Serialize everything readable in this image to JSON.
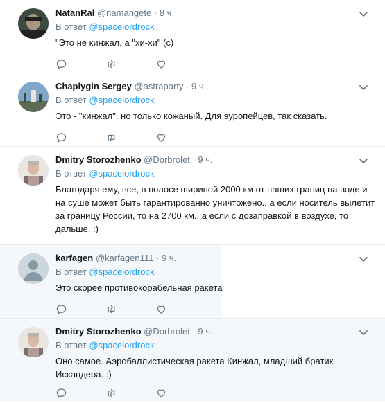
{
  "tweets": [
    {
      "name": "NatanRal",
      "handle": "@namangete",
      "time": "8 ч.",
      "reply_prefix": "В ответ",
      "reply_mention": "@spacelordrock",
      "text": "\"Это не кинжал, а \"хи-хи\" (с)"
    },
    {
      "name": "Chaplygin Sergey",
      "handle": "@astraparty",
      "time": "9 ч.",
      "reply_prefix": "В ответ",
      "reply_mention": "@spacelordrock",
      "text": "Это - \"кинжал\", но только кожаный. Для эуропейцев, так сказать."
    },
    {
      "name": "Dmitry Storozhenko",
      "handle": "@Dorbrolet",
      "time": "9 ч.",
      "reply_prefix": "В ответ",
      "reply_mention": "@spacelordrock",
      "text": "Благодаря ему, все, в полосе шириной 2000 км от наших границ на воде и на суше может быть гарантированно уничтожено., а если носитель вылетит за границу России, то на 2700 км., а если с дозаправкой в воздухе, то дальше. :)"
    },
    {
      "name": "karfagen",
      "handle": "@karfagen111",
      "time": "9 ч.",
      "reply_prefix": "В ответ",
      "reply_mention": "@spacelordrock",
      "text": "Это скорее противокорабельная ракета"
    },
    {
      "name": "Dmitry Storozhenko",
      "handle": "@Dorbrolet",
      "time": "9 ч.",
      "reply_prefix": "В ответ",
      "reply_mention": "@spacelordrock",
      "text": "Оно самое. Аэробаллистическая ракета Кинжал, младший братик Искандера. :)"
    }
  ],
  "icons": {
    "reply": "reply-icon",
    "retweet": "retweet-icon",
    "like": "heart-icon",
    "menu": "chevron-down-icon"
  },
  "colors": {
    "accent": "#1da1f2",
    "muted": "#657786",
    "text": "#14171a",
    "hover_bg": "#f5f8fa"
  }
}
